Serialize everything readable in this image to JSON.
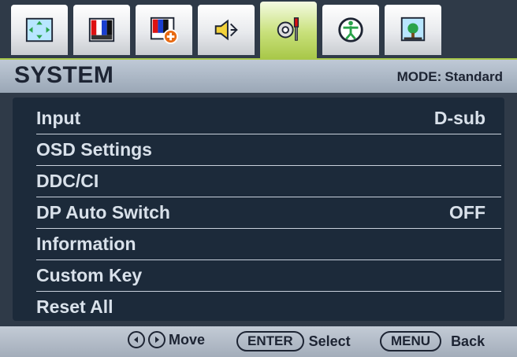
{
  "tabs": [
    {
      "icon": "picture-move-icon"
    },
    {
      "icon": "color-bars-icon"
    },
    {
      "icon": "color-bars-plus-icon"
    },
    {
      "icon": "speaker-icon"
    },
    {
      "icon": "system-tools-icon",
      "active": true
    },
    {
      "icon": "eco-icon"
    },
    {
      "icon": "mode-picture-icon"
    }
  ],
  "header": {
    "title": "SYSTEM",
    "mode_label": "MODE:",
    "mode_value": "Standard"
  },
  "menu": [
    {
      "label": "Input",
      "value": "D-sub"
    },
    {
      "label": "OSD Settings",
      "value": ""
    },
    {
      "label": "DDC/CI",
      "value": ""
    },
    {
      "label": "DP Auto Switch",
      "value": "OFF"
    },
    {
      "label": "Information",
      "value": ""
    },
    {
      "label": "Custom Key",
      "value": ""
    },
    {
      "label": "Reset All",
      "value": ""
    }
  ],
  "footer": {
    "move": "Move",
    "enter": "ENTER",
    "select": "Select",
    "menu": "MENU",
    "back": "Back"
  },
  "colors": {
    "active_tab": "#a9c84a",
    "panel": "#1c2a3a",
    "text": "#d9e1ea"
  }
}
